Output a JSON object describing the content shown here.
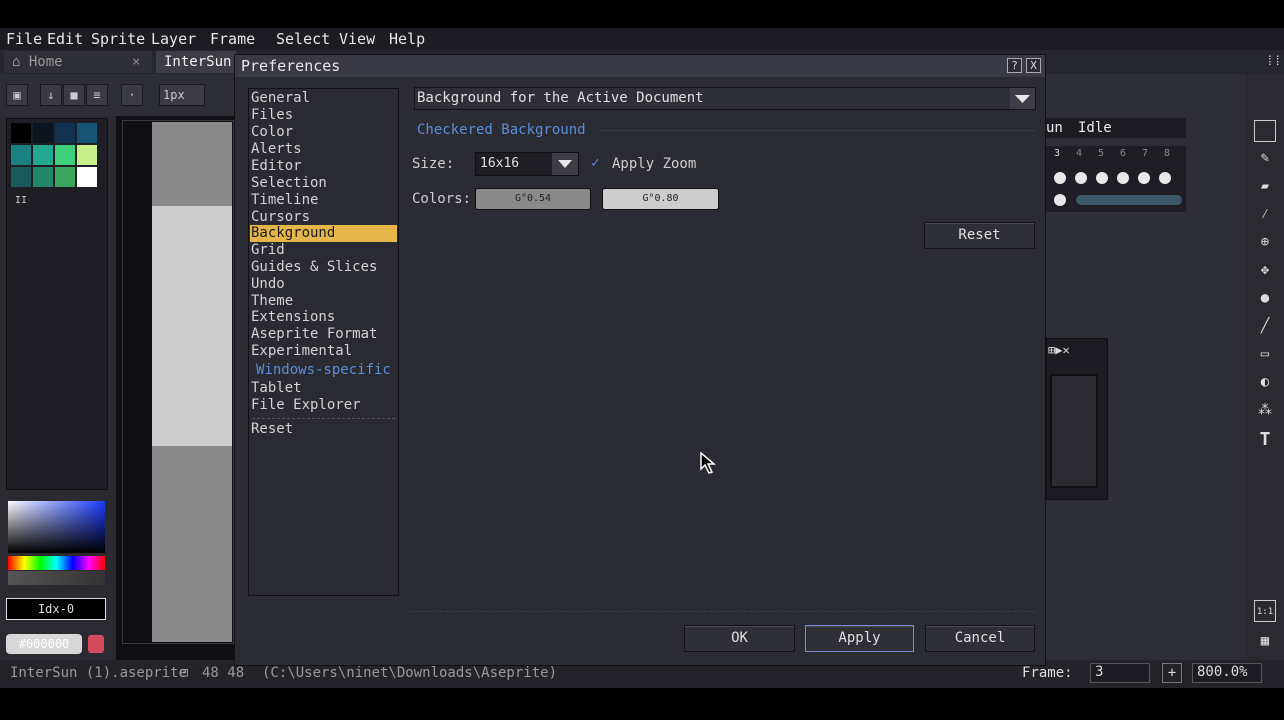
{
  "menubar": [
    "File",
    "Edit",
    "Sprite",
    "Layer",
    "Frame",
    "Select",
    "View",
    "Help"
  ],
  "tabs": {
    "home": "Home",
    "doc": "InterSun"
  },
  "toolbar": {
    "brush_size": "1px"
  },
  "left_panel": {
    "color_index": "Idx-0",
    "hex_value": "#000000"
  },
  "timeline": {
    "tag_partial": "un",
    "tag_idle": "Idle",
    "frames": [
      "3",
      "4",
      "5",
      "6",
      "7",
      "8"
    ]
  },
  "dialog": {
    "title": "Preferences",
    "help_btn": "?",
    "close_btn": "X",
    "sections": [
      "General",
      "Files",
      "Color",
      "Alerts",
      "Editor",
      "Selection",
      "Timeline",
      "Cursors",
      "Background",
      "Grid",
      "Guides & Slices",
      "Undo",
      "Theme",
      "Extensions",
      "Aseprite Format",
      "Experimental"
    ],
    "selected_section": "Background",
    "windows_header": "Windows-specific",
    "windows_sections": [
      "Tablet",
      "File Explorer"
    ],
    "reset_section": "Reset",
    "document_combo": "Background for the Active Document",
    "group_title": "Checkered Background",
    "size_label": "Size:",
    "size_value": "16x16",
    "apply_zoom_label": "Apply Zoom",
    "apply_zoom_checked": true,
    "colors_label": "Colors:",
    "color1": "G°0.54",
    "color2": "G°0.80",
    "reset_button": "Reset",
    "ok_button": "OK",
    "apply_button": "Apply",
    "cancel_button": "Cancel"
  },
  "statusbar": {
    "filename": "InterSun (1).aseprite",
    "dims": "48 48",
    "path": "(C:\\Users\\ninet\\Downloads\\Aseprite)",
    "frame_label": "Frame:",
    "frame_value": "3",
    "zoom": "800.0%"
  },
  "colors": {
    "selected_section": "#e6b64a",
    "accent_blue": "#5c8fd8",
    "dialog_bg": "#2b2b33"
  }
}
